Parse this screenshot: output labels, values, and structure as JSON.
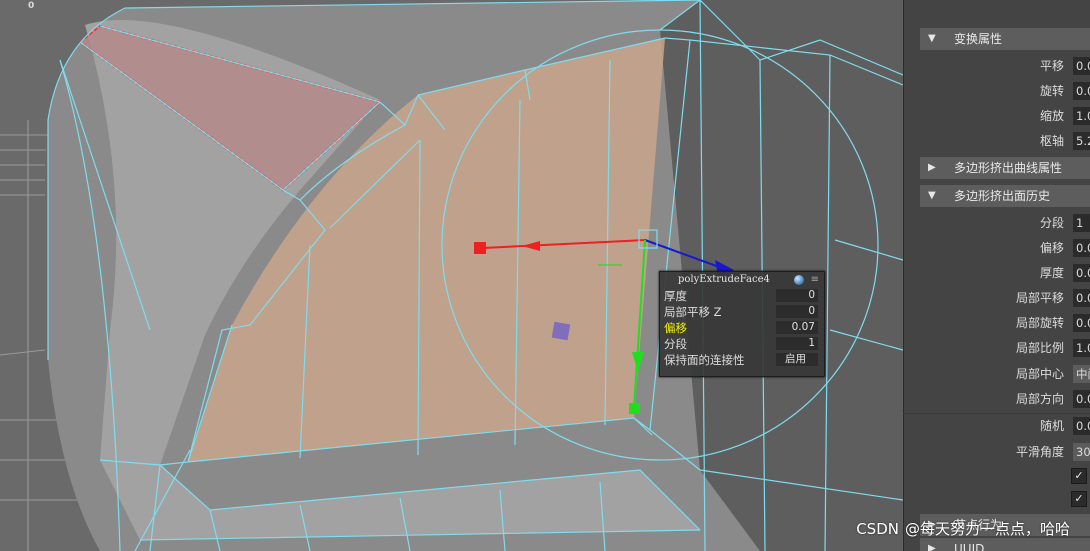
{
  "viewport": {
    "frame_number": "0",
    "colors": {
      "wireframe": "#7fdcee",
      "selected_edge": "#ff2020",
      "manipulator_x": "#ee2020",
      "manipulator_y": "#20dd20",
      "manipulator_z": "#1818cc",
      "face_fill": "#c8a48c"
    }
  },
  "hud": {
    "title": "polyExtrudeFace4",
    "rows": [
      {
        "label": "厚度",
        "value": "0"
      },
      {
        "label": "局部平移 Z",
        "value": "0"
      },
      {
        "label": "偏移",
        "value": "0.07"
      },
      {
        "label": "分段",
        "value": "1"
      },
      {
        "label": "保持面的连接性",
        "value": "启用"
      }
    ]
  },
  "attribute_editor": {
    "sections": {
      "transform": "变换属性",
      "curve": "多边形挤出曲线属性",
      "history": "多边形挤出面历史",
      "node_behavior": "节点行为",
      "uuid": "UUID"
    },
    "transform_attrs": [
      {
        "label": "平移",
        "value": "0.0"
      },
      {
        "label": "旋转",
        "value": "0.0"
      },
      {
        "label": "缩放",
        "value": "1.0"
      },
      {
        "label": "枢轴",
        "value": "5.2"
      }
    ],
    "history_attrs": [
      {
        "label": "分段",
        "value": "1"
      },
      {
        "label": "偏移",
        "value": "0.0"
      },
      {
        "label": "厚度",
        "value": "0.0"
      },
      {
        "label": "局部平移",
        "value": "0.0"
      },
      {
        "label": "局部旋转",
        "value": "0.0"
      },
      {
        "label": "局部比例",
        "value": "1.0"
      },
      {
        "label": "局部中心",
        "value": "中间"
      },
      {
        "label": "局部方向",
        "value": "0.0"
      },
      {
        "label": "随机",
        "value": "0.0"
      },
      {
        "label": "平滑角度",
        "value": "30"
      }
    ]
  },
  "watermark": {
    "prefix": "CSDN",
    "author": "@每天努力一点点，哈哈"
  }
}
